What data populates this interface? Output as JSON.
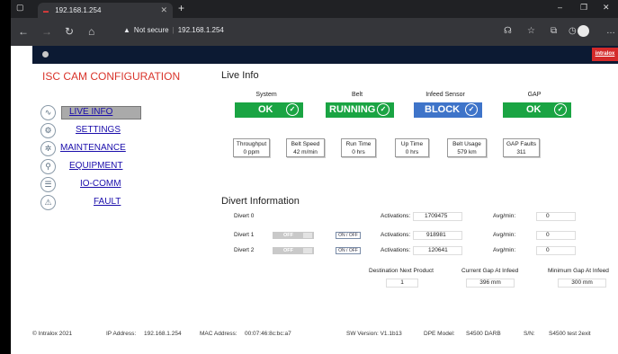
{
  "browser": {
    "tab_title": "192.168.1.254",
    "new_tab": "+",
    "security": "Not secure",
    "url": "192.168.1.254"
  },
  "app": {
    "brand": "intralox",
    "title": "ISC CAM CONFIGURATION",
    "nav": [
      {
        "label": "LIVE INFO",
        "icon": "pulse-icon"
      },
      {
        "label": "SETTINGS",
        "icon": "gear-icon"
      },
      {
        "label": "MAINTENANCE",
        "icon": "tools-icon"
      },
      {
        "label": "EQUIPMENT",
        "icon": "wrench-icon"
      },
      {
        "label": "IO-COMM",
        "icon": "database-icon"
      },
      {
        "label": "FAULT",
        "icon": "warning-icon"
      }
    ]
  },
  "live_info": {
    "heading": "Live Info",
    "status": [
      {
        "label": "System",
        "value": "OK",
        "color": "#1aa443"
      },
      {
        "label": "Belt",
        "value": "RUNNING",
        "color": "#1aa443"
      },
      {
        "label": "Infeed Sensor",
        "value": "BLOCK",
        "color": "#3e74c9"
      },
      {
        "label": "GAP",
        "value": "OK",
        "color": "#1aa443"
      }
    ],
    "metrics": [
      {
        "label": "Throughput",
        "value": "0 ppm"
      },
      {
        "label": "Belt Speed",
        "value": "42 m/min"
      },
      {
        "label": "Run Time",
        "value": "0 hrs"
      },
      {
        "label": "Up Time",
        "value": "0 hrs"
      },
      {
        "label": "Belt Usage",
        "value": "579 km"
      },
      {
        "label": "GAP Faults",
        "value": "311"
      }
    ]
  },
  "divert": {
    "heading": "Divert Information",
    "rows": [
      {
        "name": "Divert 0",
        "activations_label": "Activations:",
        "activations": "1709475",
        "avg_label": "Avg/min:",
        "avg": "0"
      },
      {
        "name": "Divert 1",
        "toggle": "OFF",
        "onoff": "ON / OFF",
        "activations_label": "Activations:",
        "activations": "918981",
        "avg_label": "Avg/min:",
        "avg": "0"
      },
      {
        "name": "Divert 2",
        "toggle": "OFF",
        "onoff": "ON / OFF",
        "activations_label": "Activations:",
        "activations": "120641",
        "avg_label": "Avg/min:",
        "avg": "0"
      }
    ],
    "dest_label": "Destination Next Product",
    "dest_value": "1",
    "gap_label": "Current Gap At Infeed",
    "gap_value": "396 mm",
    "min_gap_label": "Minimum Gap At Infeed",
    "min_gap_value": "300 mm"
  },
  "footer": {
    "copyright": "© Intralox 2021",
    "ip_label": "IP Address:",
    "ip": "192.168.1.254",
    "mac_label": "MAC Address:",
    "mac": "00:07:46:8c:bc:a7",
    "sw": "SW Version: V1.1b13",
    "dpe_label": "DPE Model:",
    "dpe": "S4500 DARB",
    "sn_label": "S/N:",
    "sn": "S4500 test 2exit"
  }
}
